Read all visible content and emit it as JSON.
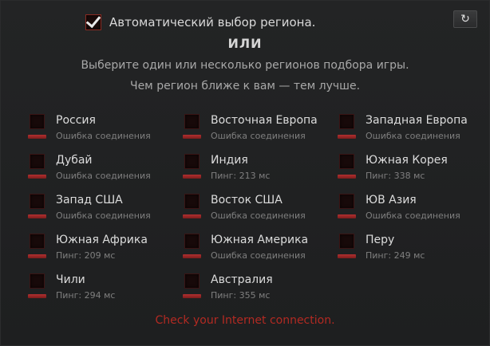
{
  "auto_select": {
    "label": "Автоматический выбор региона.",
    "checked": true
  },
  "or_label": "ИЛИ",
  "hint_line1": "Выберите один или несколько регионов подбора игры.",
  "hint_line2": "Чем регион ближе к вам — тем лучше.",
  "reset_icon": "refresh-icon",
  "regions": [
    {
      "name": "Россия",
      "status": "Ошибка соединения"
    },
    {
      "name": "Восточная Европа",
      "status": "Ошибка соединения"
    },
    {
      "name": "Западная Европа",
      "status": "Ошибка соединения"
    },
    {
      "name": "Дубай",
      "status": "Ошибка соединения"
    },
    {
      "name": "Индия",
      "status": "Пинг: 213 мс"
    },
    {
      "name": "Южная Корея",
      "status": "Пинг: 338 мс"
    },
    {
      "name": "Запад США",
      "status": "Ошибка соединения"
    },
    {
      "name": "Восток США",
      "status": "Ошибка соединения"
    },
    {
      "name": "ЮВ Азия",
      "status": "Ошибка соединения"
    },
    {
      "name": "Южная Африка",
      "status": "Пинг: 209 мс"
    },
    {
      "name": "Южная Америка",
      "status": "Ошибка соединения"
    },
    {
      "name": "Перу",
      "status": "Пинг: 249 мс"
    },
    {
      "name": "Чили",
      "status": "Пинг: 294 мс"
    },
    {
      "name": "Австралия",
      "status": "Пинг: 355 мс"
    }
  ],
  "error_message": "Check your Internet connection.",
  "colors": {
    "accent_red": "#b22a22",
    "background": "#1f2021"
  }
}
